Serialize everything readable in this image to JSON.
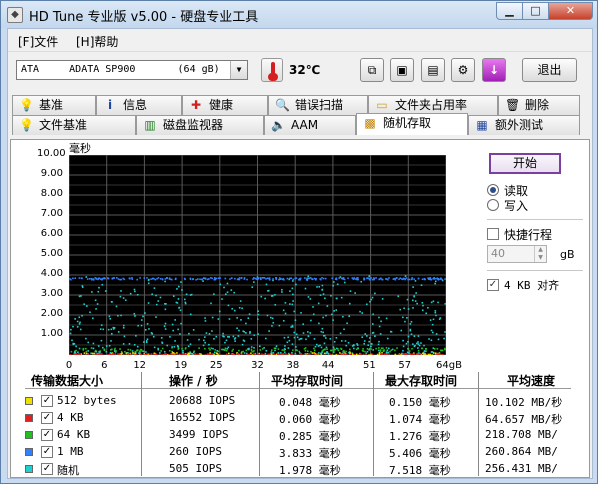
{
  "app": {
    "title": "HD Tune 专业版 v5.00 - 硬盘专业工具"
  },
  "menu": {
    "file": "[F]文件",
    "help": "[H]帮助"
  },
  "toolbar": {
    "drive": "ATA     ADATA SP900       (64 gB)",
    "temperature": "32℃",
    "exit_label": "退出"
  },
  "tabs_top": [
    "基准",
    "信息",
    "健康",
    "错误扫描",
    "文件夹占用率",
    "删除"
  ],
  "tabs_bottom": [
    "文件基准",
    "磁盘监视器",
    "AAM",
    "随机存取",
    "额外测试"
  ],
  "active_tab": "随机存取",
  "controls": {
    "start_label": "开始",
    "read_label": "读取",
    "write_label": "写入",
    "mode": "read",
    "fast_label": "快捷行程",
    "fast_checked": false,
    "fast_value": "40",
    "fast_unit": "gB",
    "align_label": "4 KB 对齐",
    "align_checked": true
  },
  "chart_data": {
    "type": "scatter",
    "ylabel": "毫秒",
    "ylim": [
      0,
      10
    ],
    "yticks": [
      "10.00",
      "9.00",
      "8.00",
      "7.00",
      "6.00",
      "5.00",
      "4.00",
      "3.00",
      "2.00",
      "1.00"
    ],
    "xlim": [
      0,
      64
    ],
    "xticks": [
      "0",
      "6",
      "12",
      "19",
      "25",
      "32",
      "38",
      "44",
      "51",
      "57",
      "64gB"
    ],
    "grid": true,
    "series": [
      {
        "name": "512 bytes",
        "color": "#f0e000",
        "band": [
          0.02,
          0.15
        ]
      },
      {
        "name": "4 KB",
        "color": "#e02020",
        "band": [
          0.04,
          0.1
        ]
      },
      {
        "name": "64 KB",
        "color": "#20c020",
        "band": [
          0.2,
          0.4
        ]
      },
      {
        "name": "1 MB",
        "color": "#3080ff",
        "band": [
          3.8,
          3.9
        ]
      },
      {
        "name": "随机",
        "color": "#20d0d0",
        "band": [
          0.1,
          4.0
        ]
      }
    ]
  },
  "table": {
    "headers": [
      "传输数据大小",
      "操作 / 秒",
      "平均存取时间",
      "最大存取时间",
      "平均速度"
    ],
    "rows": [
      {
        "label": "512 bytes",
        "color": "#f0e000",
        "ops": "20688 IOPS",
        "avg": "0.048 毫秒",
        "max": "0.150 毫秒",
        "speed": "10.102 MB/秒"
      },
      {
        "label": "4 KB",
        "color": "#e02020",
        "ops": "16552 IOPS",
        "avg": "0.060 毫秒",
        "max": "1.074 毫秒",
        "speed": "64.657 MB/秒"
      },
      {
        "label": "64 KB",
        "color": "#20c020",
        "ops": "3499 IOPS",
        "avg": "0.285 毫秒",
        "max": "1.276 毫秒",
        "speed": "218.708 MB/"
      },
      {
        "label": "1 MB",
        "color": "#3080ff",
        "ops": "260 IOPS",
        "avg": "3.833 毫秒",
        "max": "5.406 毫秒",
        "speed": "260.864 MB/"
      },
      {
        "label": "随机",
        "color": "#20d0d0",
        "ops": "505 IOPS",
        "avg": "1.978 毫秒",
        "max": "7.518 毫秒",
        "speed": "256.431 MB/"
      }
    ]
  }
}
